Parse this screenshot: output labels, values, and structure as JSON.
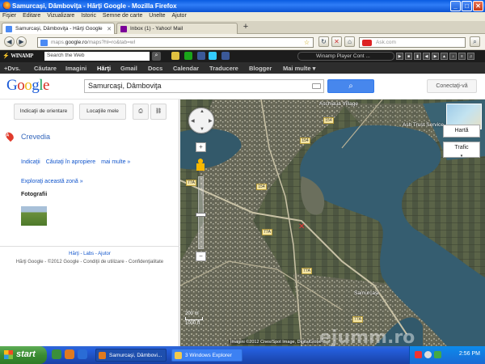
{
  "window": {
    "title": "Samurcaşi, Dâmboviţa - Hărţi Google - Mozilla Firefox"
  },
  "menu": [
    "Fişier",
    "Editare",
    "Vizualizare",
    "Istoric",
    "Semne de carte",
    "Unelte",
    "Ajutor"
  ],
  "tabs": [
    {
      "label": "Samurcaşi, Dâmboviţa - Hărţi Google"
    },
    {
      "label": "Inbox (1) - Yahoo! Mail"
    }
  ],
  "nav": {
    "url_prefix": "maps.",
    "url_host": "google.ro",
    "url_rest": "/maps?hl=ro&tab=wl",
    "search_placeholder": "Ask.com"
  },
  "winamp": {
    "logo": "WINAMP",
    "search": "Search the Web",
    "player": "Winamp Player Cont ..."
  },
  "google_bar": {
    "items": [
      "+Dvs.",
      "Căutare",
      "Imagini",
      "Hărţi",
      "Gmail",
      "Docs",
      "Calendar",
      "Traducere",
      "Blogger",
      "Mai multe ▾"
    ],
    "selected": "Hărţi"
  },
  "header": {
    "logo": "Google",
    "query": "Samurcaşi, Dâmboviţa",
    "connect": "Conectaţi-vă"
  },
  "panel": {
    "directions": "Indicaţii de orientare",
    "my_places": "Locaţiile mele",
    "place_name": "Crevedia",
    "links": [
      "Indicaţii",
      "Căutaţi în apropiere",
      "mai multe »"
    ],
    "explore": "Exploraţi această zonă »",
    "photos": "Fotografii",
    "footer_line1": "Hărţi - Labs - Ajutor",
    "footer_line2": "Hărţi Google - ©2012 Google - Condiţii de utilizare - Confidenţialitate"
  },
  "map": {
    "map_type": "Hartă",
    "traffic": "Trafic",
    "scale_metric": "200 m",
    "scale_imperial": "1000 ft",
    "attribution": "Imagini ©2012 Cnes/Spot Image, DigitalGlobe",
    "village_label": "Samurcaşi",
    "labels": {
      "top_village": "Aschiaua Village",
      "service": "Ash Trust Service"
    },
    "road_numbers": [
      "154",
      "154",
      "77A",
      "154",
      "77A",
      "77A",
      "77A"
    ],
    "watermark": "ejumm.ro"
  },
  "taskbar": {
    "start": "start",
    "items": [
      {
        "label": "Samurcaşi, Dâmbovi..."
      },
      {
        "label": "3 Windows Explorer"
      }
    ],
    "clock": "2:56 PM"
  },
  "colors": {
    "google_blue": "#4787ed",
    "xp_blue": "#245edb",
    "start_green": "#3a8c32"
  }
}
